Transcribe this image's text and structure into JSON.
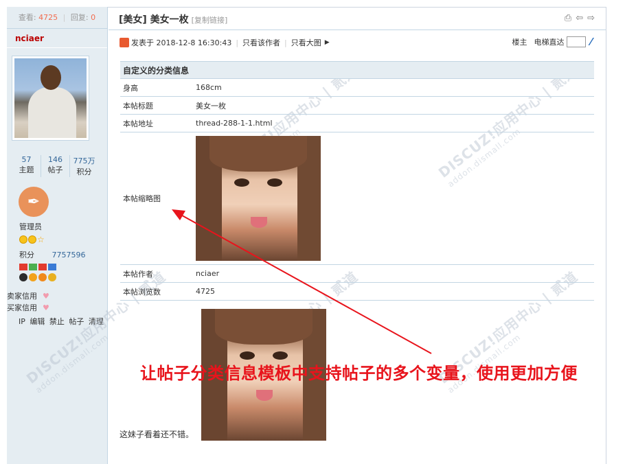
{
  "sidebar": {
    "views_label": "查看:",
    "views_value": "4725",
    "replies_label": "回复:",
    "replies_value": "0",
    "username": "nciaer",
    "counts": [
      {
        "value": "57",
        "label": "主题"
      },
      {
        "value": "146",
        "label": "帖子"
      },
      {
        "value": "775万",
        "label": "积分"
      }
    ],
    "group": "管理员",
    "points_label": "积分",
    "points_value": "7757596",
    "seller_credit": "卖家信用",
    "buyer_credit": "买家信用",
    "actions": [
      "IP",
      "编辑",
      "禁止",
      "帖子",
      "清理"
    ]
  },
  "header": {
    "title": "[美女] 美女一枚",
    "copy_link": "[复制链接]"
  },
  "info": {
    "posted": "发表于 2018-12-8 16:30:43",
    "only_author": "只看该作者",
    "only_images": "只看大图",
    "owner": "楼主",
    "elevator": "电梯直达"
  },
  "table": {
    "title": "自定义的分类信息",
    "rows": [
      {
        "key": "身高",
        "value": "168cm"
      },
      {
        "key": "本帖标题",
        "value": "美女一枚"
      },
      {
        "key": "本帖地址",
        "value": "thread-288-1-1.html"
      },
      {
        "key": "本帖缩略图",
        "value": ""
      },
      {
        "key": "本帖作者",
        "value": "nciaer"
      },
      {
        "key": "本帖浏览数",
        "value": "4725"
      }
    ]
  },
  "annotation": "让帖子分类信息模板中支持帖子的多个变量，使用更加方便",
  "body_text": "这妹子看着还不错。",
  "watermark": {
    "brand": "DISCUZ!应用中心 | 贰道",
    "url": "addon.dismall.com"
  },
  "colors": {
    "sidebar_bg": "#e5edf2",
    "border": "#c2d5e3",
    "annotation": "#e8141c",
    "username": "#bb0000"
  }
}
